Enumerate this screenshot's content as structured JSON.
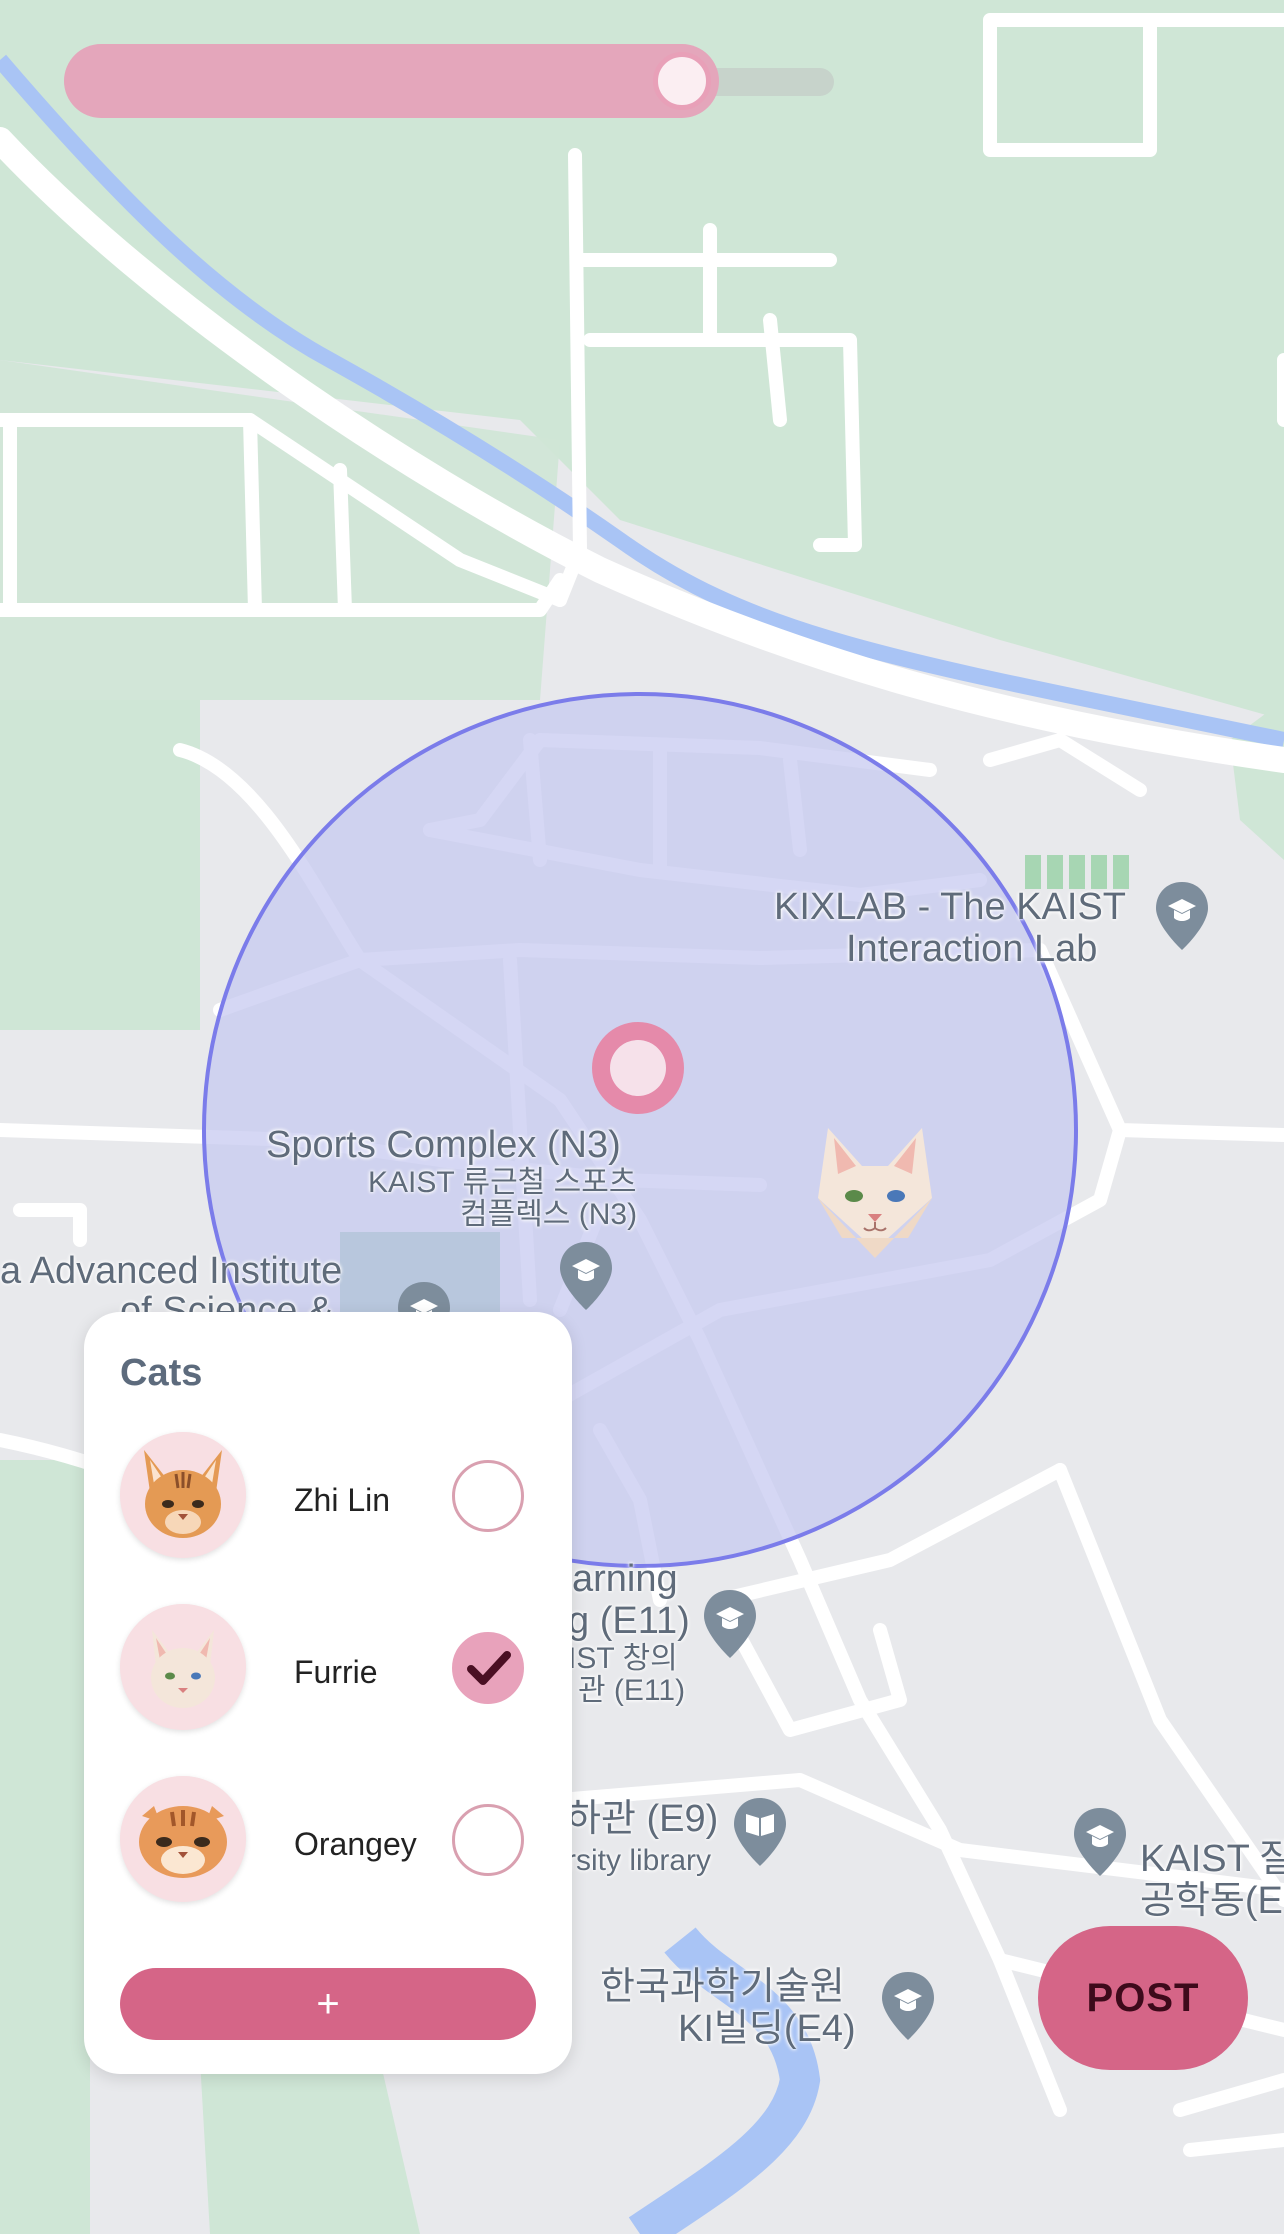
{
  "slider": {
    "value": 0.85
  },
  "map": {
    "labels": {
      "kixlab_1": "KIXLAB - The KAIST",
      "kixlab_2": "Interaction Lab",
      "sports_1": "Sports Complex (N3)",
      "sports_2": "KAIST 류근철 스포츠",
      "sports_3": "컴플렉스 (N3)",
      "institute_1": "a Advanced Institute",
      "institute_2": "of Science &",
      "e11_1": "arning",
      "e11_2": "g (E11)",
      "e11_3": "IST 창의",
      "e11_4": "관 (E11)",
      "e9_1": "하관 (E9)",
      "e9_2": "rsity library",
      "e4_1": "한국과학기술원",
      "e4_2": "KI빌딩(E4)",
      "kaist_eng_1": "KAIST 잘",
      "kaist_eng_2": "공학동(E"
    },
    "icons": [
      "school-pin-icon",
      "library-pin-icon",
      "location-marker-icon",
      "cat-marker-icon"
    ]
  },
  "cats_panel": {
    "title": "Cats",
    "cats": [
      {
        "name": "Zhi Lin",
        "selected": false,
        "avatar_icon": "cat-abyssinian-icon"
      },
      {
        "name": "Furrie",
        "selected": true,
        "avatar_icon": "cat-white-icon"
      },
      {
        "name": "Orangey",
        "selected": false,
        "avatar_icon": "cat-orange-icon"
      }
    ],
    "add_label": "+"
  },
  "post_button": {
    "label": "POST"
  },
  "colors": {
    "accent": "#d56587",
    "slider_fill": "#e4a6bb",
    "radius_fill": "#c7c9f0",
    "radius_stroke": "#7b7cea",
    "park": "#cfe6d6",
    "water": "#a9c4f5",
    "road": "#ffffff"
  }
}
